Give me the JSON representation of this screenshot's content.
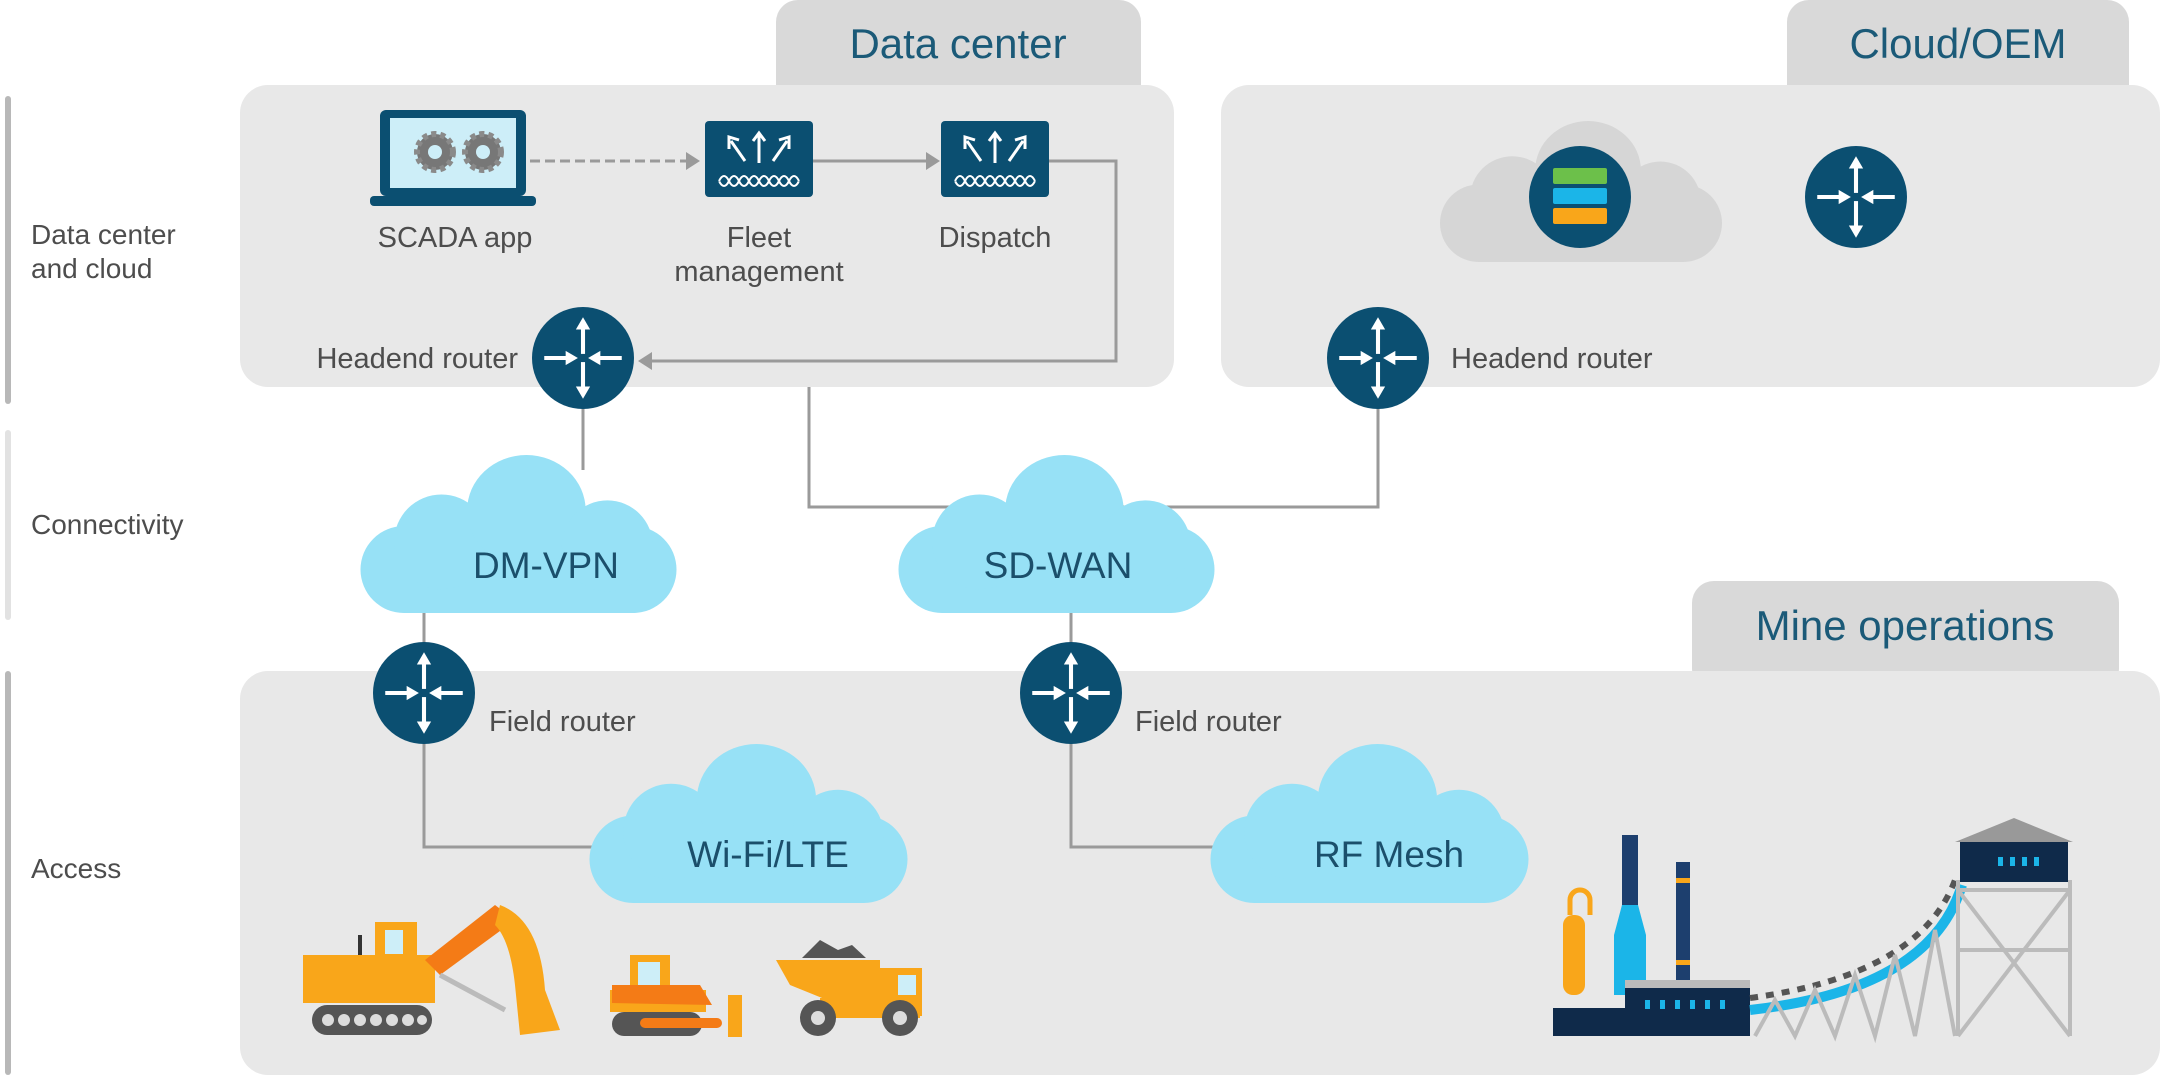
{
  "colors": {
    "panel": "#e8e8e8",
    "tab": "#d9d9d9",
    "device": "#0b4f71",
    "cloud": "#97e1f6",
    "machinery": "#f9a61a",
    "accent_orange": "#f47b16"
  },
  "side_labels": {
    "datacenter_cloud": [
      "Data center",
      "and cloud"
    ],
    "connectivity": "Connectivity",
    "access": "Access"
  },
  "data_center": {
    "tab": "Data center",
    "scada": "SCADA app",
    "fleet": [
      "Fleet",
      "management"
    ],
    "dispatch": "Dispatch",
    "headend": "Headend router"
  },
  "cloud_oem": {
    "tab": "Cloud/OEM",
    "headend": "Headend router"
  },
  "connectivity": {
    "dmvpn": "DM-VPN",
    "sdwan": "SD-WAN"
  },
  "mine_operations": {
    "tab": "Mine operations",
    "field_router_1": "Field router",
    "field_router_2": "Field router",
    "wifi": "Wi-Fi/LTE",
    "rfmesh": "RF Mesh"
  },
  "icons": [
    "laptop-gears-icon",
    "fleet-app-icon",
    "dispatch-app-icon",
    "router-icon",
    "server-cloud-icon",
    "excavator-icon",
    "bulldozer-icon",
    "dump-truck-icon",
    "processing-plant-icon"
  ]
}
